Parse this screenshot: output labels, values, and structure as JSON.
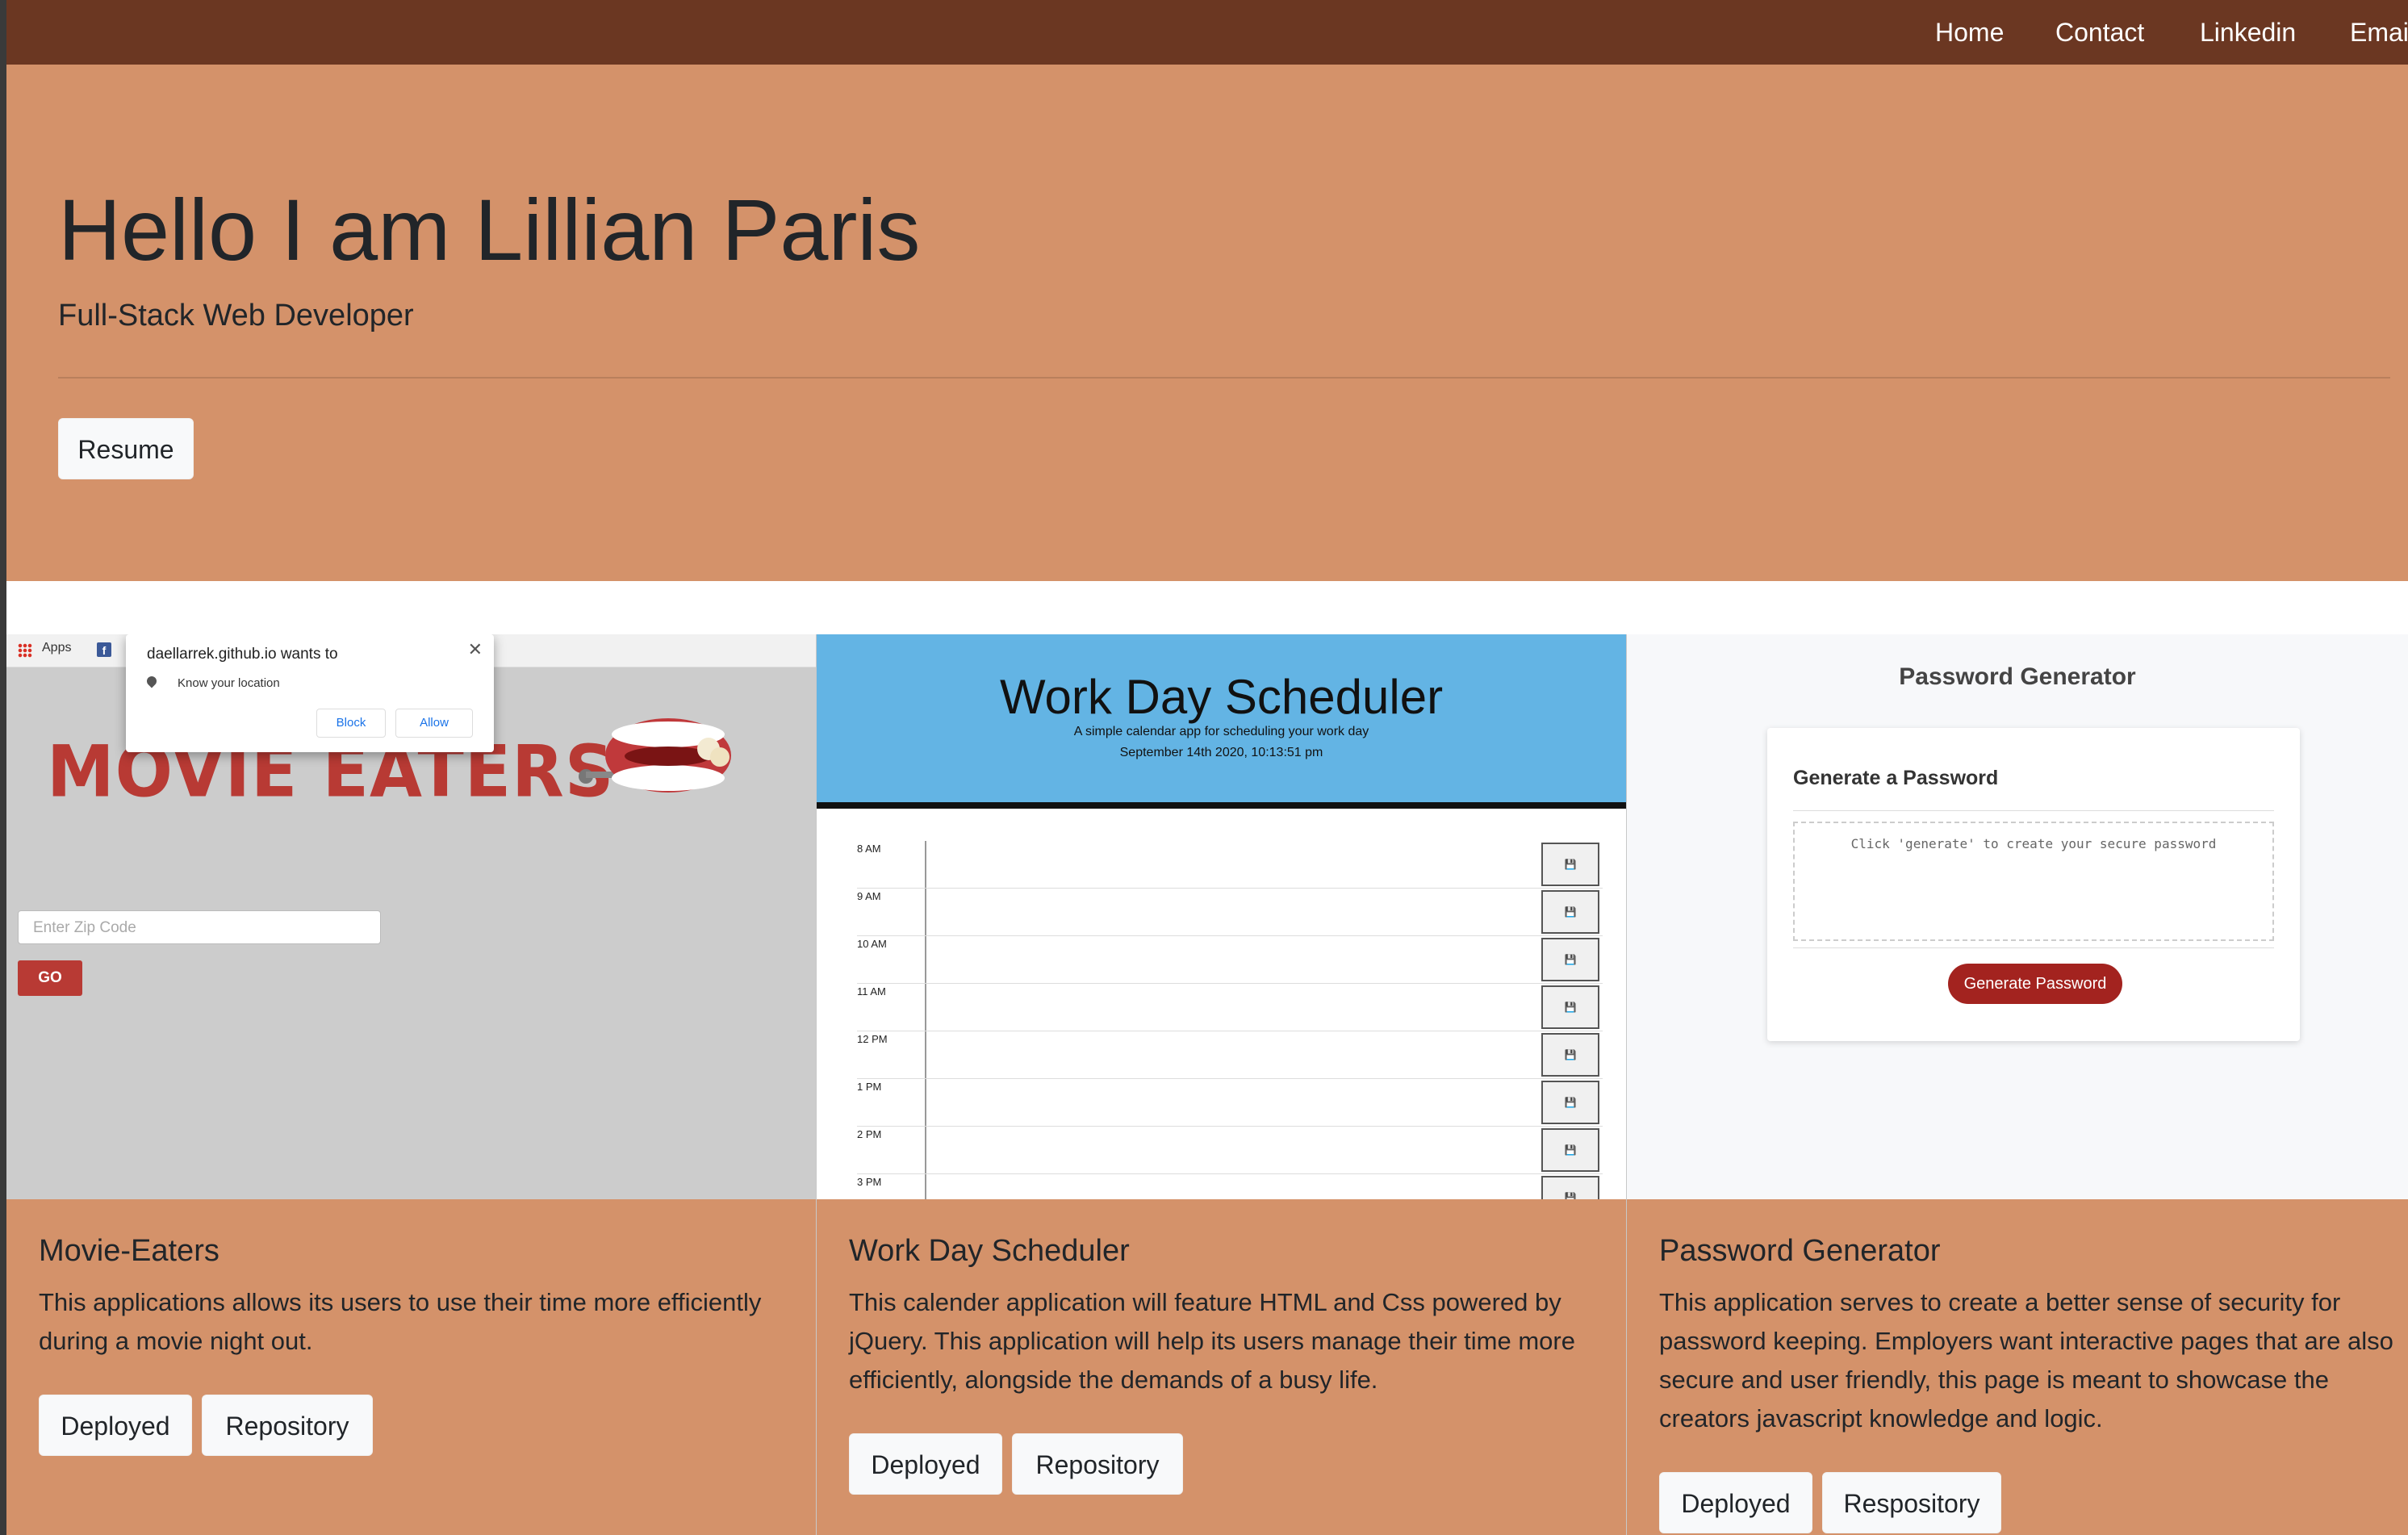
{
  "nav": {
    "links": [
      "Home",
      "Contact",
      "Linkedin",
      "Emai"
    ]
  },
  "hero": {
    "title": "Hello I am Lillian Paris",
    "subtitle": "Full-Stack Web Developer",
    "resume_label": "Resume"
  },
  "colors": {
    "navbar": "#6b3722",
    "accent": "#d4926a",
    "button": "#f8f9fa"
  },
  "cards": [
    {
      "title": "Movie-Eaters",
      "text": "This applications allows its users to use their time more efficiently during a movie night out.",
      "buttons": [
        "Deployed",
        "Repository"
      ],
      "thumb": {
        "apps_label": "Apps",
        "popup_title": "daellarrek.github.io wants to",
        "popup_text": "Know your location",
        "popup_block": "Block",
        "popup_allow": "Allow",
        "logo_text": "MOVIE EATERS",
        "zip_placeholder": "Enter Zip Code",
        "go_label": "GO"
      }
    },
    {
      "title": "Work Day Scheduler",
      "text": "This calender application will feature HTML and Css powered by jQuery. This application will help its users manage their time more efficiently, alongside the demands of a busy life.",
      "buttons": [
        "Deployed",
        "Repository"
      ],
      "thumb": {
        "title": "Work Day Scheduler",
        "subtitle": "A simple calendar app for scheduling your work day",
        "date": "September 14th 2020, 10:13:51 pm",
        "hours": [
          "8 AM",
          "9 AM",
          "10 AM",
          "11 AM",
          "12 PM",
          "1 PM",
          "2 PM",
          "3 PM"
        ],
        "save_icon": "💾"
      }
    },
    {
      "title": "Password Generator",
      "text": "This application serves to create a better sense of security for password keeping. Employers want interactive pages that are also secure and user friendly, this page is meant to showcase the creators javascript knowledge and logic.",
      "buttons": [
        "Deployed",
        "Respository"
      ],
      "thumb": {
        "heading": "Password Generator",
        "card_heading": "Generate a Password",
        "placeholder": "Click 'generate' to create your secure password",
        "button": "Generate Password"
      }
    }
  ]
}
